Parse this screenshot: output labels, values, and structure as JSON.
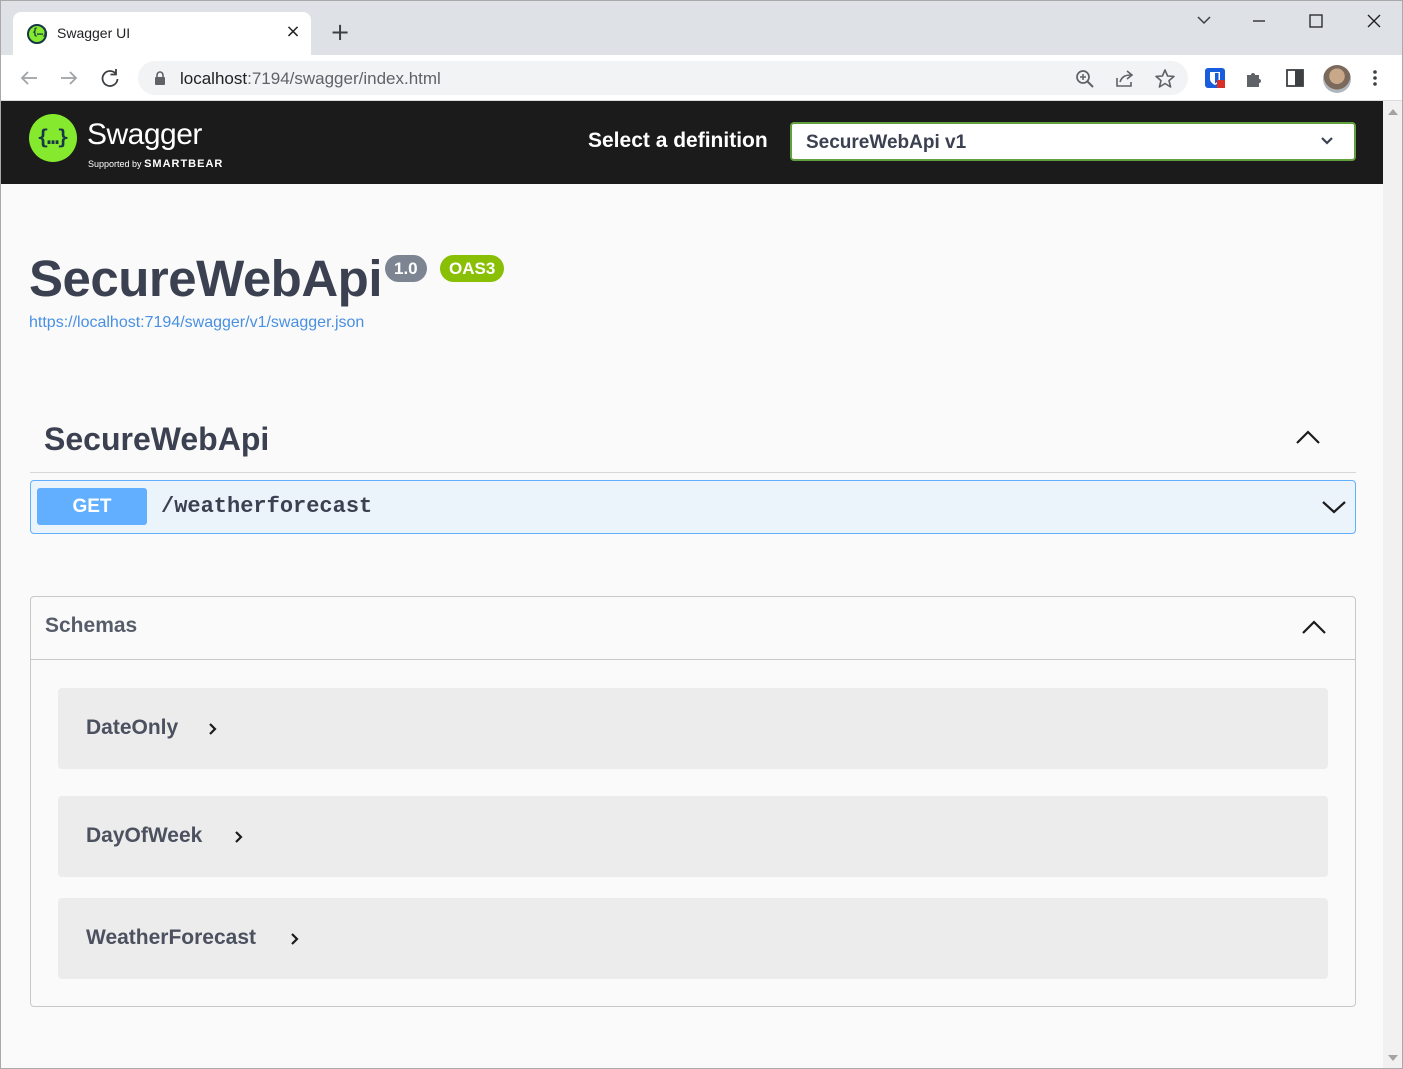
{
  "browser": {
    "tab_title": "Swagger UI",
    "url_host": "localhost",
    "url_rest": ":7194/swagger/index.html"
  },
  "topbar": {
    "brand": "Swagger",
    "brand_sub_prefix": "Supported by",
    "brand_sub_company": "SMARTBEAR",
    "definition_label": "Select a definition",
    "definition_selected": "SecureWebApi v1"
  },
  "info": {
    "title": "SecureWebApi",
    "version_badge": "1.0",
    "oas_badge": "OAS3",
    "spec_url": "https://localhost:7194/swagger/v1/swagger.json"
  },
  "tag": {
    "name": "SecureWebApi",
    "expanded": true
  },
  "operations": [
    {
      "method": "GET",
      "path": "/weatherforecast"
    }
  ],
  "schemas": {
    "title": "Schemas",
    "expanded": true,
    "models": [
      "DateOnly",
      "DayOfWeek",
      "WeatherForecast"
    ]
  },
  "colors": {
    "topbar_bg": "#1b1b1b",
    "swagger_green": "#85ea2d",
    "select_border": "#62a03f",
    "get_blue": "#61affe",
    "get_bg": "#ebf3fb",
    "badge_grey": "#7d8492",
    "oas_green": "#89bf04",
    "link_blue": "#4990e2"
  }
}
